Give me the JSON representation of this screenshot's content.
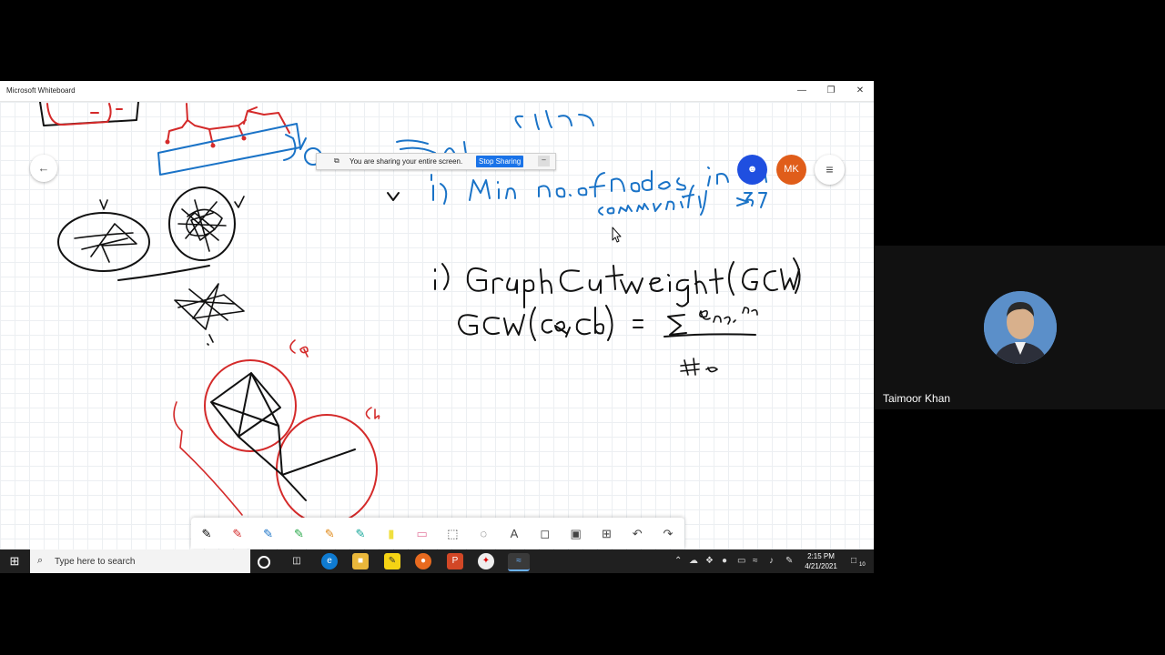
{
  "window": {
    "title": "Microsoft Whiteboard",
    "minimize_glyph": "—",
    "restore_glyph": "❐",
    "close_glyph": "✕"
  },
  "whiteboard": {
    "back_glyph": "←",
    "share_notification": {
      "text": "You are sharing your entire screen.",
      "stop_label": "Stop Sharing",
      "minimize_glyph": "–"
    },
    "participants": [
      {
        "initials": "",
        "color": "#1f4fe0"
      },
      {
        "initials": "MK",
        "color": "#e05d1a"
      }
    ],
    "menu_glyph": "≡",
    "tools": [
      {
        "name": "pen-black-tool",
        "glyph": "✎",
        "color": "#000000"
      },
      {
        "name": "pen-red-tool",
        "glyph": "✎",
        "color": "#d42a2a"
      },
      {
        "name": "pen-blue-tool",
        "glyph": "✎",
        "color": "#1a73c7"
      },
      {
        "name": "pen-green-tool",
        "glyph": "✎",
        "color": "#2aa84a"
      },
      {
        "name": "pen-orange-tool",
        "glyph": "✎",
        "color": "#e08a1a"
      },
      {
        "name": "pen-teal-tool",
        "glyph": "✎",
        "color": "#1aa89a"
      },
      {
        "name": "highlighter-tool",
        "glyph": "▮",
        "color": "#f0e040"
      },
      {
        "name": "eraser-tool",
        "glyph": "▭",
        "color": "#e47aa0"
      },
      {
        "name": "lasso-select-tool",
        "glyph": "⬚",
        "color": "#444444"
      },
      {
        "name": "ruler-tool",
        "glyph": "◌",
        "color": "#444444"
      },
      {
        "name": "text-tool",
        "glyph": "A",
        "color": "#444444"
      },
      {
        "name": "note-tool",
        "glyph": "◻",
        "color": "#444444"
      },
      {
        "name": "image-tool",
        "glyph": "▣",
        "color": "#444444"
      },
      {
        "name": "add-tool",
        "glyph": "⊞",
        "color": "#444444"
      },
      {
        "name": "undo-tool",
        "glyph": "↶",
        "color": "#444444"
      },
      {
        "name": "redo-tool",
        "glyph": "↷",
        "color": "#444444"
      }
    ]
  },
  "taskbar": {
    "start_glyph": "⊞",
    "search_placeholder": "Type here to search",
    "search_glyph": "⌕",
    "time": "2:15 PM",
    "date": "4/21/2021",
    "notification_count": "10"
  },
  "video": {
    "participant_name": "Taimoor Khan"
  }
}
